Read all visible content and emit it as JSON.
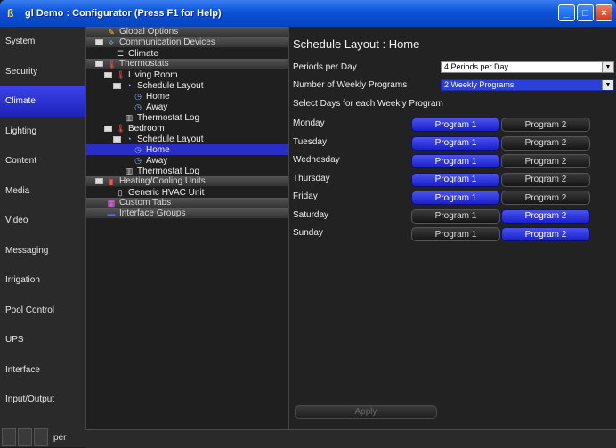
{
  "window": {
    "title": "gl Demo : Configurator  (Press F1 for Help)"
  },
  "nav": {
    "items": [
      "System",
      "Security",
      "Climate",
      "Lighting",
      "Content",
      "Media",
      "Video",
      "Messaging",
      "Irrigation",
      "Pool Control",
      "UPS",
      "Interface",
      "Input/Output"
    ],
    "active": "Climate",
    "footer_fragment": "per"
  },
  "tree": {
    "rows": [
      {
        "label": "Global Options",
        "indent": 0,
        "type": "hdr",
        "icon": "options-icon"
      },
      {
        "label": "Communication Devices",
        "indent": 0,
        "type": "hdr",
        "expand": true,
        "icon": "devices-icon"
      },
      {
        "label": "Climate",
        "indent": 1,
        "type": "item",
        "icon": "device-icon"
      },
      {
        "label": "Thermostats",
        "indent": 0,
        "type": "hdr",
        "expand": true,
        "icon": "thermometer-icon"
      },
      {
        "label": "Living Room",
        "indent": 1,
        "type": "item",
        "expand": true,
        "icon": "thermometer-icon"
      },
      {
        "label": "Schedule Layout",
        "indent": 2,
        "type": "item",
        "expand": true,
        "icon": "schedule-icon"
      },
      {
        "label": "Home",
        "indent": 3,
        "type": "item",
        "icon": "clock-icon"
      },
      {
        "label": "Away",
        "indent": 3,
        "type": "item",
        "icon": "clock-icon"
      },
      {
        "label": "Thermostat Log",
        "indent": 2,
        "type": "item",
        "icon": "log-icon"
      },
      {
        "label": "Bedroom",
        "indent": 1,
        "type": "item",
        "expand": true,
        "icon": "thermometer-icon"
      },
      {
        "label": "Schedule Layout",
        "indent": 2,
        "type": "item",
        "expand": true,
        "icon": "schedule-icon"
      },
      {
        "label": "Home",
        "indent": 3,
        "type": "sel",
        "icon": "clock-icon"
      },
      {
        "label": "Away",
        "indent": 3,
        "type": "item",
        "icon": "clock-icon"
      },
      {
        "label": "Thermostat Log",
        "indent": 2,
        "type": "item",
        "icon": "log-icon"
      },
      {
        "label": "Heating/Cooling Units",
        "indent": 0,
        "type": "hdr",
        "expand": true,
        "icon": "hvac-icon"
      },
      {
        "label": "Generic HVAC Unit",
        "indent": 1,
        "type": "item",
        "icon": "hvac-unit-icon"
      },
      {
        "label": "Custom Tabs",
        "indent": 0,
        "type": "hdr",
        "icon": "tabs-icon"
      },
      {
        "label": "Interface Groups",
        "indent": 0,
        "type": "hdr",
        "icon": "groups-icon"
      }
    ]
  },
  "content": {
    "title": "Schedule Layout : Home",
    "periods_label": "Periods per Day",
    "periods_value": "4 Periods per Day",
    "programs_label": "Number of Weekly Programs",
    "programs_value": "2 Weekly Programs",
    "select_days_label": "Select Days for each Weekly Program",
    "program1_label": "Program 1",
    "program2_label": "Program 2",
    "days": [
      {
        "name": "Monday",
        "selected": 1
      },
      {
        "name": "Tuesday",
        "selected": 1
      },
      {
        "name": "Wednesday",
        "selected": 1
      },
      {
        "name": "Thursday",
        "selected": 1
      },
      {
        "name": "Friday",
        "selected": 1
      },
      {
        "name": "Saturday",
        "selected": 2
      },
      {
        "name": "Sunday",
        "selected": 2
      }
    ],
    "apply_label": "Apply"
  },
  "colors": {
    "accent": "#2a2ec8",
    "titlebar": "#0a52d8"
  }
}
